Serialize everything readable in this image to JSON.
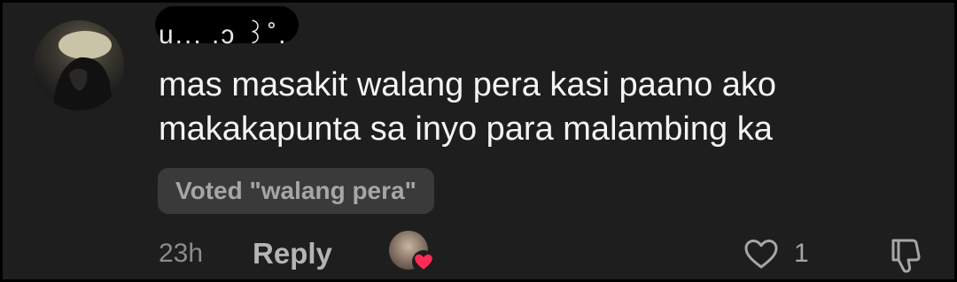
{
  "comment": {
    "username": "u... .ɔ ꒱˚.",
    "text": "mas masakit walang pera kasi paano ako\nmakakapunta sa inyo para malambing ka",
    "vote_badge": "Voted \"walang pera\"",
    "time": "23h",
    "reply_label": "Reply",
    "like_count": "1"
  },
  "colors": {
    "background": "#1e1e1e",
    "text_primary": "#f4f4f4",
    "text_secondary": "#a6a6a6",
    "badge_bg": "#3a3a3a",
    "heart": "#fe2c55"
  },
  "icons": {
    "like": "heart-outline-icon",
    "dislike": "thumbs-down-outline-icon",
    "creator_liked": "red-heart-icon"
  }
}
